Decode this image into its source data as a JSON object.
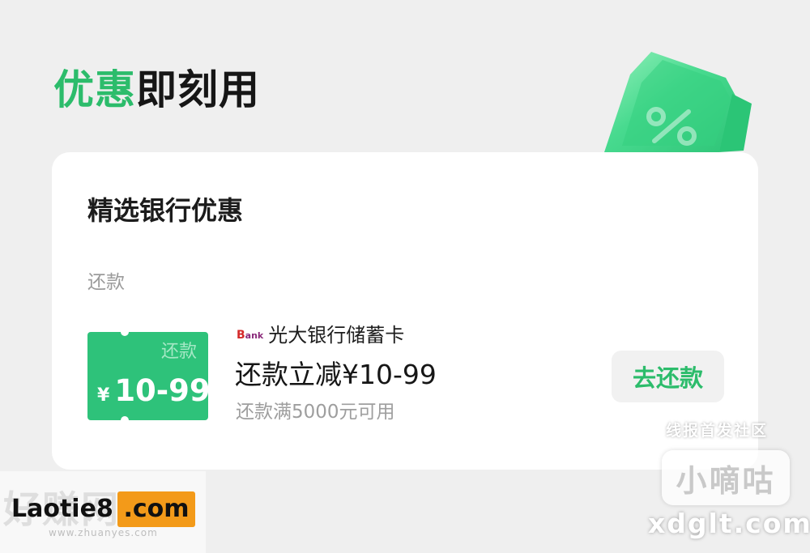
{
  "header": {
    "title_accent": "优惠",
    "title_rest": "即刻用",
    "accent_color": "#2cbc6b"
  },
  "illustration": {
    "icon": "percent-coupon-icon",
    "glyph": "%"
  },
  "card": {
    "section_title": "精选银行优惠",
    "category_label": "还款",
    "offer": {
      "ticket": {
        "tag": "还款",
        "currency": "¥",
        "amount": "10-99",
        "color": "#2ec27a"
      },
      "bank_logo_text": "Bank",
      "bank_name": "光大银行储蓄卡",
      "title": "还款立减¥10-99",
      "condition": "还款满5000元可用",
      "button_label": "去还款"
    }
  },
  "watermarks": {
    "right_caption": "线报首发社区",
    "right_badge": "小嘀咕",
    "right_domain": "xdglt.com",
    "left_faint_title": "好赚网",
    "left_faint_url": "www.zhuanyes.com",
    "left_name": "Laotie8",
    "left_tld": ".com"
  }
}
